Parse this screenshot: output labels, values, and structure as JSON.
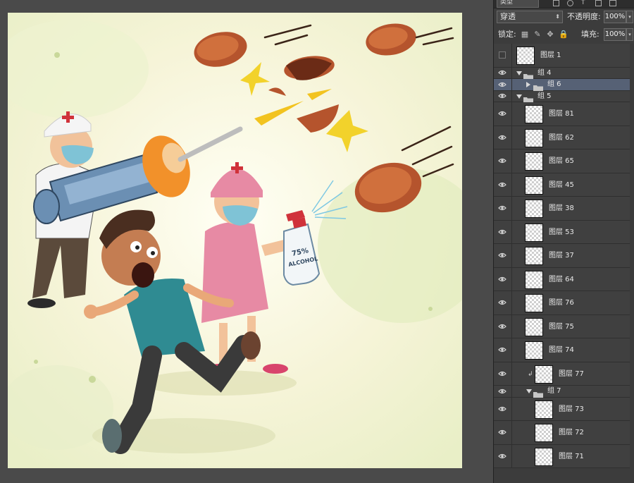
{
  "panel": {
    "top_kind_label": "类型",
    "blend_mode": "穿透",
    "opacity_label": "不透明度:",
    "opacity_value": "100%",
    "lock_label": "锁定:",
    "fill_label": "填充:",
    "fill_value": "100%"
  },
  "layers": [
    {
      "name": "图层 1",
      "type": "layer",
      "visible": false,
      "indent": 0
    },
    {
      "name": "组 4",
      "type": "group",
      "expanded": true,
      "visible": true,
      "indent": 0
    },
    {
      "name": "组 6",
      "type": "group",
      "expanded": false,
      "visible": true,
      "indent": 1,
      "selected": true
    },
    {
      "name": "组 5",
      "type": "group",
      "expanded": true,
      "visible": true,
      "indent": 0
    },
    {
      "name": "图层 81",
      "type": "layer",
      "visible": true,
      "indent": 1
    },
    {
      "name": "图层 62",
      "type": "layer",
      "visible": true,
      "indent": 1
    },
    {
      "name": "图层 65",
      "type": "layer",
      "visible": true,
      "indent": 1
    },
    {
      "name": "图层 45",
      "type": "layer",
      "visible": true,
      "indent": 1
    },
    {
      "name": "图层 38",
      "type": "layer",
      "visible": true,
      "indent": 1
    },
    {
      "name": "图层 53",
      "type": "layer",
      "visible": true,
      "indent": 1
    },
    {
      "name": "图层 37",
      "type": "layer",
      "visible": true,
      "indent": 1
    },
    {
      "name": "图层 64",
      "type": "layer",
      "visible": true,
      "indent": 1
    },
    {
      "name": "图层 76",
      "type": "layer",
      "visible": true,
      "indent": 1
    },
    {
      "name": "图层 75",
      "type": "layer",
      "visible": true,
      "indent": 1
    },
    {
      "name": "图层 74",
      "type": "layer",
      "visible": true,
      "indent": 1
    },
    {
      "name": "图层 77",
      "type": "layer",
      "visible": true,
      "indent": 1,
      "clipped": true
    },
    {
      "name": "组 7",
      "type": "group",
      "expanded": true,
      "visible": true,
      "indent": 1
    },
    {
      "name": "图层 73",
      "type": "layer",
      "visible": true,
      "indent": 2
    },
    {
      "name": "图层 72",
      "type": "layer",
      "visible": true,
      "indent": 2
    },
    {
      "name": "图层 71",
      "type": "layer",
      "visible": true,
      "indent": 2
    }
  ],
  "canvas": {
    "bottle_label_line1": "75%",
    "bottle_label_line2": "ALCOHOL"
  },
  "colors": {
    "panel_bg": "#3c3c3c",
    "selected_row": "#566175",
    "workspace": "#4a4a4a"
  }
}
